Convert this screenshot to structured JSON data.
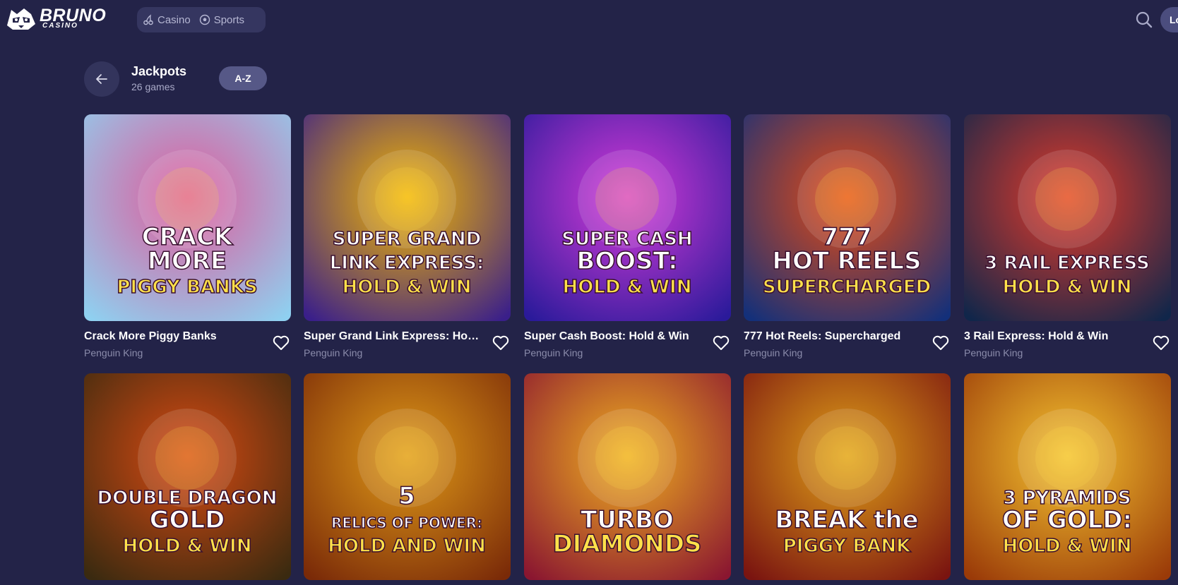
{
  "header": {
    "logo_text": "BRUNO",
    "logo_subtext": "CASINO",
    "nav": [
      {
        "label": "Casino",
        "icon": "cherry-icon"
      },
      {
        "label": "Sports",
        "icon": "soccer-ball-icon"
      }
    ],
    "search_icon": "search-icon",
    "login_label": "Lo"
  },
  "section": {
    "title": "Jackpots",
    "count": "26 games",
    "sort_label": "A-Z"
  },
  "games": [
    {
      "title": "Crack More Piggy Banks",
      "provider": "Penguin King",
      "art": [
        "CRACK",
        "MORE",
        "PIGGY BANKS"
      ],
      "colors": [
        "#8fd0f0",
        "#e05a9a"
      ]
    },
    {
      "title": "Super Grand Link Express: Hold…",
      "provider": "Penguin King",
      "art": [
        "SUPER GRAND",
        "LINK EXPRESS:",
        "HOLD & WIN"
      ],
      "colors": [
        "#3a1f8a",
        "#f5b800"
      ]
    },
    {
      "title": "Super Cash Boost: Hold & Win",
      "provider": "Penguin King",
      "art": [
        "SUPER CASH",
        "BOOST:",
        "HOLD & WIN"
      ],
      "colors": [
        "#2a1a9a",
        "#d63bd8"
      ]
    },
    {
      "title": "777 Hot Reels: Supercharged",
      "provider": "Penguin King",
      "art": [
        "777",
        "HOT REELS",
        "SUPERCHARGED"
      ],
      "colors": [
        "#13307a",
        "#e84b12"
      ]
    },
    {
      "title": "3 Rail Express: Hold & Win",
      "provider": "Penguin King",
      "art": [
        "3 RAIL EXPRESS",
        "HOLD & WIN"
      ],
      "colors": [
        "#10264a",
        "#e23a2a"
      ]
    },
    {
      "title": "Double Dragon Gold",
      "provider": "",
      "art": [
        "DOUBLE DRAGON",
        "GOLD",
        "HOLD & WIN"
      ],
      "colors": [
        "#3a2a10",
        "#d84a12"
      ]
    },
    {
      "title": "5 Relics of Power",
      "provider": "",
      "art": [
        "5",
        "RELICS OF POWER:",
        "HOLD AND WIN"
      ],
      "colors": [
        "#7a2a08",
        "#e09a18"
      ]
    },
    {
      "title": "Turbo Diamonds",
      "provider": "",
      "art": [
        "TURBO",
        "DIAMONDS"
      ],
      "colors": [
        "#8a1630",
        "#f0b020"
      ]
    },
    {
      "title": "Break the Piggy Bank",
      "provider": "",
      "art": [
        "BREAK the",
        "PIGGY BANK"
      ],
      "colors": [
        "#7a1410",
        "#e0a018"
      ]
    },
    {
      "title": "3 Pyramids of Gold",
      "provider": "",
      "art": [
        "3 PYRAMIDS",
        "OF GOLD:",
        "HOLD & WIN"
      ],
      "colors": [
        "#9a3a08",
        "#f5c430"
      ]
    }
  ],
  "fav_icon": "heart-icon",
  "back_icon": "arrow-left-icon"
}
